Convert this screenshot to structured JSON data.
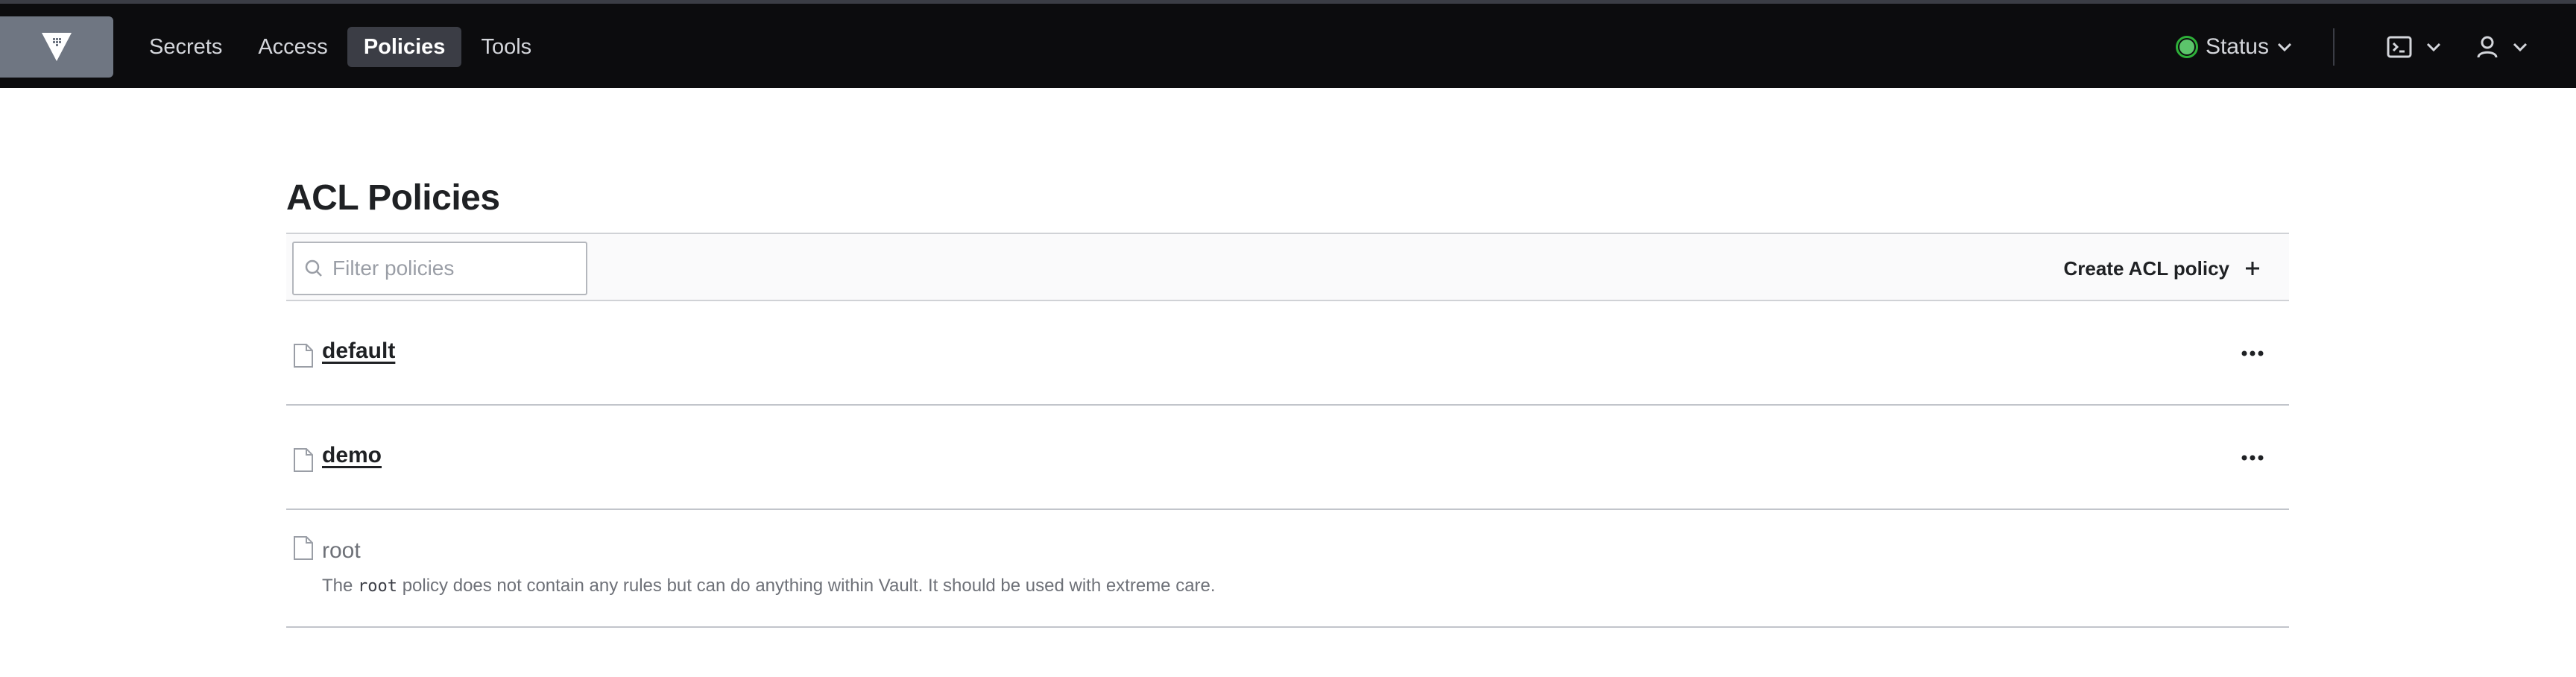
{
  "nav": {
    "items": [
      {
        "label": "Secrets"
      },
      {
        "label": "Access"
      },
      {
        "label": "Policies",
        "active": true
      },
      {
        "label": "Tools"
      }
    ],
    "status_label": "Status",
    "status_color": "#2eb039"
  },
  "page": {
    "title": "ACL Policies"
  },
  "toolbar": {
    "filter_placeholder": "Filter policies",
    "filter_value": "",
    "create_label": "Create ACL policy"
  },
  "policies": [
    {
      "name": "default",
      "link": true
    },
    {
      "name": "demo",
      "link": true
    },
    {
      "name": "root",
      "link": false,
      "description_prefix": "The",
      "description_code": "root",
      "description_suffix": "policy does not contain any rules but can do anything within Vault. It should be used with extreme care."
    }
  ]
}
